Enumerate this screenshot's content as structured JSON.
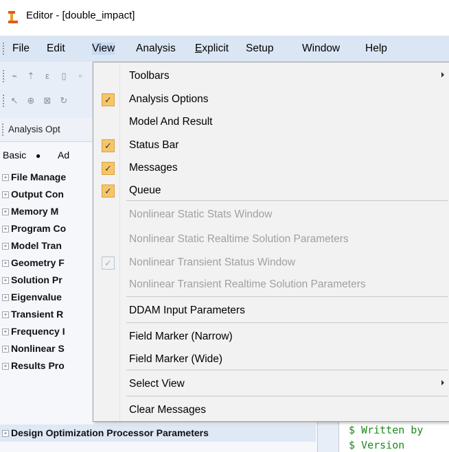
{
  "window": {
    "title": "Editor - [double_impact]"
  },
  "menubar": {
    "items": [
      {
        "label": "File",
        "active": false
      },
      {
        "label": "Edit",
        "active": false
      },
      {
        "label": "View",
        "active": true
      },
      {
        "label": "Analysis",
        "active": false
      },
      {
        "label": "Explicit",
        "active": false
      },
      {
        "label": "Setup",
        "active": false
      },
      {
        "label": "Window",
        "active": false
      },
      {
        "label": "Help",
        "active": false
      }
    ]
  },
  "panel": {
    "header": "Analysis Opt",
    "mode_basic": "Basic",
    "mode_advanced": "Ad",
    "tree": [
      "File Manage",
      "Output Con",
      "Memory M",
      "Program Co",
      "Model Tran",
      "Geometry F",
      "Solution Pr",
      "Eigenvalue",
      "Transient R",
      "Frequency I",
      "Nonlinear S",
      "Results Pro",
      "Design Optimization Processor Parameters"
    ]
  },
  "code": {
    "lines": [
      "$ Written by",
      "$ Version"
    ]
  },
  "view_menu": {
    "items": [
      {
        "label": "Toolbars",
        "checked": false,
        "disabled": false,
        "submenu": true
      },
      {
        "label": "Analysis Options",
        "checked": true,
        "disabled": false,
        "submenu": false
      },
      {
        "label": "Model And Result",
        "checked": false,
        "disabled": false,
        "submenu": false
      },
      {
        "label": "Status Bar",
        "checked": true,
        "disabled": false,
        "submenu": false
      },
      {
        "label": "Messages",
        "checked": true,
        "disabled": false,
        "submenu": false
      },
      {
        "label": "Queue",
        "checked": true,
        "disabled": false,
        "submenu": false
      },
      {
        "label": "Nonlinear Static Stats Window",
        "checked": false,
        "disabled": true,
        "submenu": false
      },
      {
        "label": "Nonlinear Static Realtime Solution Parameters",
        "checked": false,
        "disabled": true,
        "submenu": false
      },
      {
        "label": "Nonlinear Transient Status Window",
        "checked": true,
        "disabled": true,
        "submenu": false
      },
      {
        "label": "Nonlinear Transient Realtime Solution Parameters",
        "checked": false,
        "disabled": true,
        "submenu": false
      },
      {
        "label": "DDAM Input Parameters",
        "checked": false,
        "disabled": false,
        "submenu": false
      },
      {
        "label": "Field Marker (Narrow)",
        "checked": false,
        "disabled": false,
        "submenu": false
      },
      {
        "label": "Field Marker (Wide)",
        "checked": false,
        "disabled": false,
        "submenu": false
      },
      {
        "label": "Select View",
        "checked": false,
        "disabled": false,
        "submenu": true
      },
      {
        "label": "Clear Messages",
        "checked": false,
        "disabled": false,
        "submenu": false
      }
    ]
  },
  "colors": {
    "menubar_bg": "#dbe6f4",
    "check_bg": "#f6c56a",
    "code_text": "#1a8a1a",
    "disabled_text": "#a0a0a0"
  }
}
